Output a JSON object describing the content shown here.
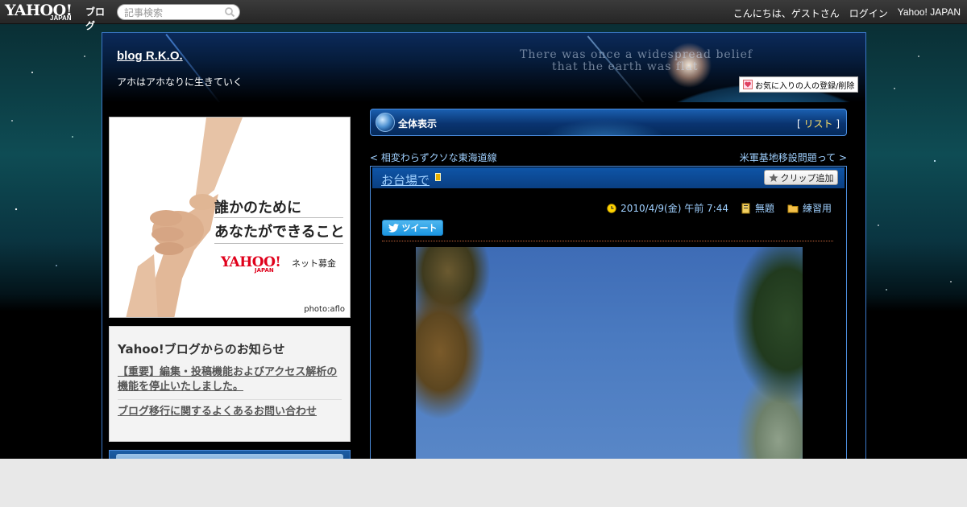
{
  "topbar": {
    "logo_text": "YAHOO!",
    "logo_sub": "JAPAN",
    "logo_service": "ブログ",
    "search_placeholder": "記事検索",
    "greeting": "こんにちは、ゲストさん",
    "login_label": "ログイン",
    "yahoo_link": "Yahoo! JAPAN"
  },
  "header": {
    "blog_title": "blog R.K.O.",
    "description": "アホはアホなりに生きていく",
    "art_text_line1": "There was once a widespread belief",
    "art_text_line2": "that the earth was flat",
    "fav_button": "お気に入りの人の登録/削除"
  },
  "ad": {
    "line1": "誰かのために",
    "line2": "あなたができること",
    "logo": "YAHOO!",
    "logo_sub": "JAPAN",
    "service": "ネット募金",
    "credit": "photo:aflo"
  },
  "notice": {
    "heading": "Yahoo!ブログからのお知らせ",
    "items": [
      "【重要】編集・投稿機能およびアクセス解析の機能を停止いたしました。",
      "ブログ移行に関するよくあるお問い合わせ"
    ]
  },
  "section": {
    "label": "全体表示",
    "list_open": "[",
    "list_label": "リスト",
    "list_close": "]"
  },
  "pager": {
    "prev_mark": "<",
    "prev_label": "相変わらずクソな東海道線",
    "next_label": "米軍基地移設問題って",
    "next_mark": ">"
  },
  "article": {
    "title": "お台場で",
    "clip_label": "クリップ追加",
    "date": "2010/4/9(金) 午前 7:44",
    "category_a": "無題",
    "category_b": "練習用",
    "tweet_label": "ツイート"
  },
  "colors": {
    "link": "#9fd0ff",
    "bar_blue": "#0a3f82",
    "list_link": "#ffe066",
    "tweet": "#1b95e0"
  }
}
